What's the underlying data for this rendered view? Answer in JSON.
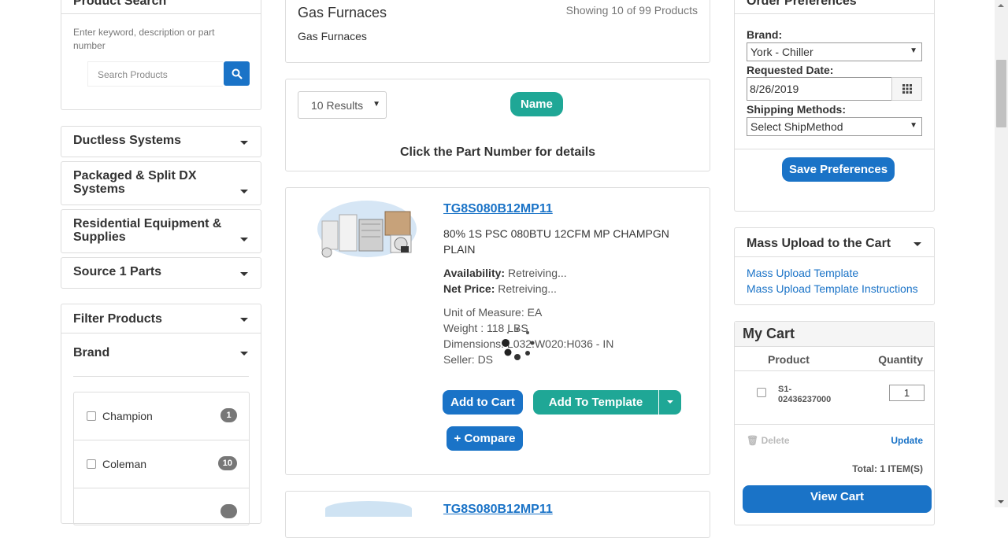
{
  "sidebar": {
    "search": {
      "title": "Product Search",
      "hint": "Enter keyword, description or part number",
      "placeholder": "Search Products"
    },
    "categories": [
      "Ductless Systems",
      "Packaged & Split DX Systems",
      "Residential Equipment & Supplies",
      "Source 1 Parts"
    ],
    "filter": {
      "title": "Filter Products",
      "brand_title": "Brand",
      "brands": [
        {
          "name": "Champion",
          "count": "1"
        },
        {
          "name": "Coleman",
          "count": "10"
        }
      ]
    }
  },
  "main": {
    "title": "Gas Furnaces",
    "showing": "Showing 10 of 99 Products",
    "subtitle": "Gas Furnaces",
    "results_select": "10 Results",
    "sort_pill": "Name",
    "hint": "Click the Part Number for details",
    "product": {
      "part_number": "TG8S080B12MP11",
      "description": "80% 1S PSC 080BTU 12CFM MP CHAMPGN PLAIN",
      "availability_label": "Availability:",
      "availability_value": "Retreiving...",
      "net_price_label": "Net Price:",
      "net_price_value": "Retreiving...",
      "unit_of_measure": "Unit of Measure: EA",
      "weight": "Weight : 118 LBS",
      "dimensions": "Dimensions: L032:W020:H036 - IN",
      "seller": "Seller: DS",
      "add_to_cart": "Add to Cart",
      "add_to_template": "Add To Template",
      "compare": "+ Compare"
    },
    "product2_part_number": "TG8S080B12MP11"
  },
  "order_prefs": {
    "title": "Order Preferences",
    "brand_label": "Brand:",
    "brand_value": "York - Chiller",
    "date_label": "Requested Date:",
    "date_value": "8/26/2019",
    "shipping_label": "Shipping Methods:",
    "shipping_value": "Select ShipMethod",
    "save": "Save Preferences"
  },
  "mass_upload": {
    "title": "Mass Upload to the Cart",
    "link1": "Mass Upload Template",
    "link2": "Mass Upload Template Instructions"
  },
  "cart": {
    "title": "My Cart",
    "col_product": "Product",
    "col_quantity": "Quantity",
    "sku": "S1-\n02436237000",
    "quantity": "1",
    "delete": "Delete",
    "update": "Update",
    "total": "Total: 1 ITEM(S)",
    "view": "View Cart"
  },
  "colors": {
    "primary_blue": "#1a73c7",
    "teal": "#1fa796"
  }
}
